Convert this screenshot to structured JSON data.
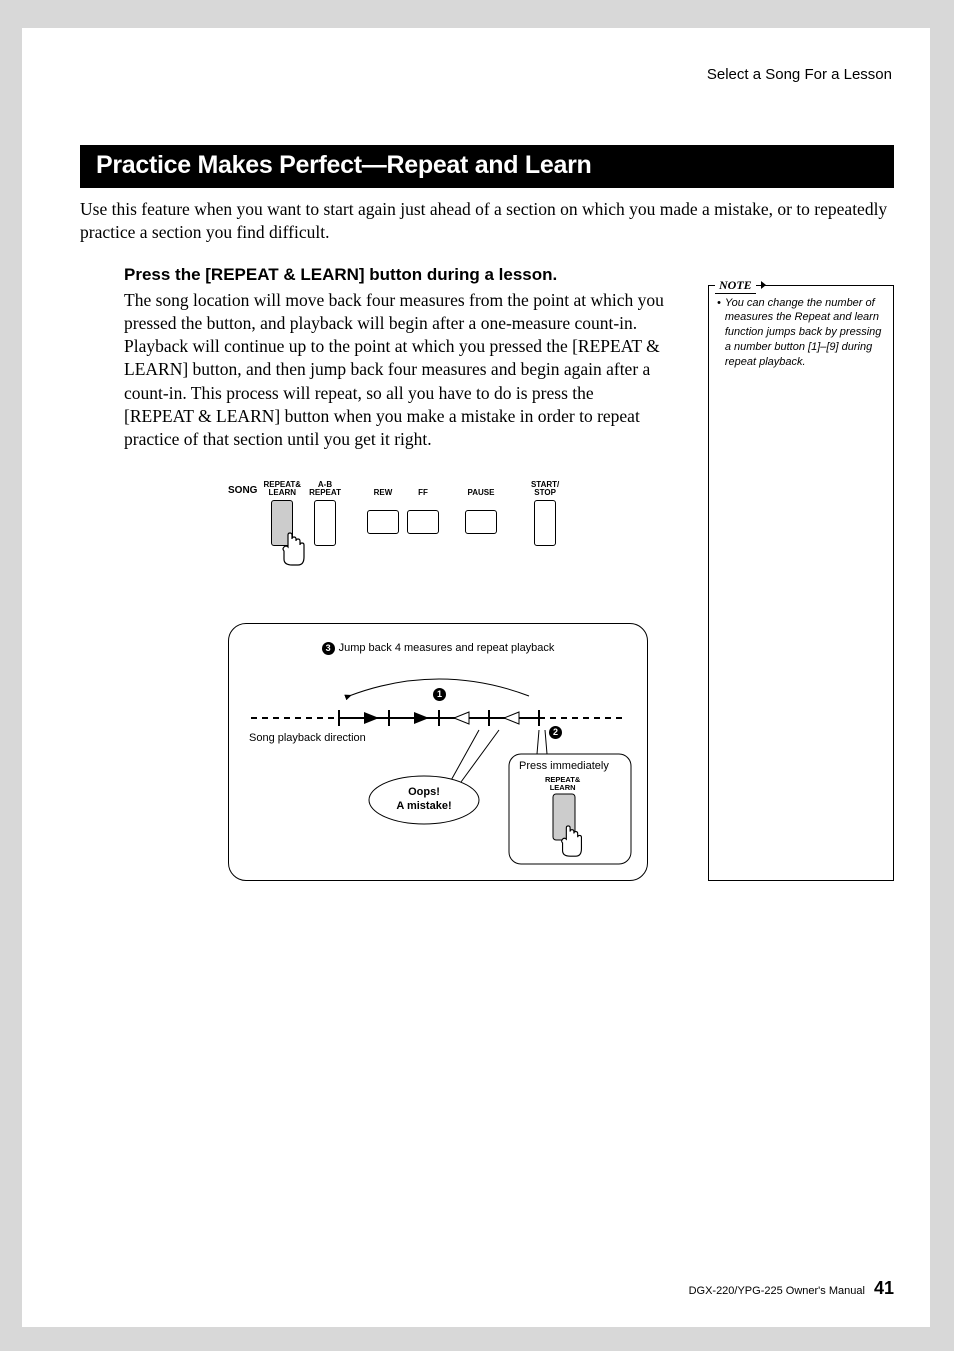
{
  "header": {
    "breadcrumb": "Select a Song For a Lesson"
  },
  "section": {
    "title": "Practice Makes Perfect—Repeat and Learn",
    "intro": "Use this feature when you want to start again just ahead of a section on which you made a mistake, or to repeatedly practice a section you find difficult.",
    "heading": "Press the [REPEAT & LEARN] button during a lesson.",
    "body": "The song location will move back four measures from the point at which you pressed the button, and playback will begin after a one-measure count-in. Playback will continue up to the point at which you pressed the [REPEAT & LEARN] button, and then jump back four measures and begin again after a count-in. This process will repeat, so all you have to do is press the [REPEAT & LEARN] button when you make a mistake in order to repeat practice of that section until you get it right."
  },
  "note": {
    "label": "NOTE",
    "text": "You can change the number of measures the Repeat and learn function jumps back by pressing a number button [1]–[9] during repeat playback."
  },
  "buttons": {
    "song": "SONG",
    "labels": [
      "REPEAT&\nLEARN",
      "A-B\nREPEAT",
      "REW",
      "FF",
      "PAUSE",
      "START/\nSTOP"
    ]
  },
  "flow": {
    "step3": "Jump back 4 measures and repeat playback",
    "step1": "1",
    "step2": "2",
    "playback_dir": "Song playback direction",
    "oops1": "Oops!",
    "oops2": "A mistake!",
    "press_immediately": "Press immediately",
    "repeat_learn": "REPEAT&\nLEARN"
  },
  "footer": {
    "text": "DGX-220/YPG-225  Owner's Manual",
    "page": "41"
  }
}
